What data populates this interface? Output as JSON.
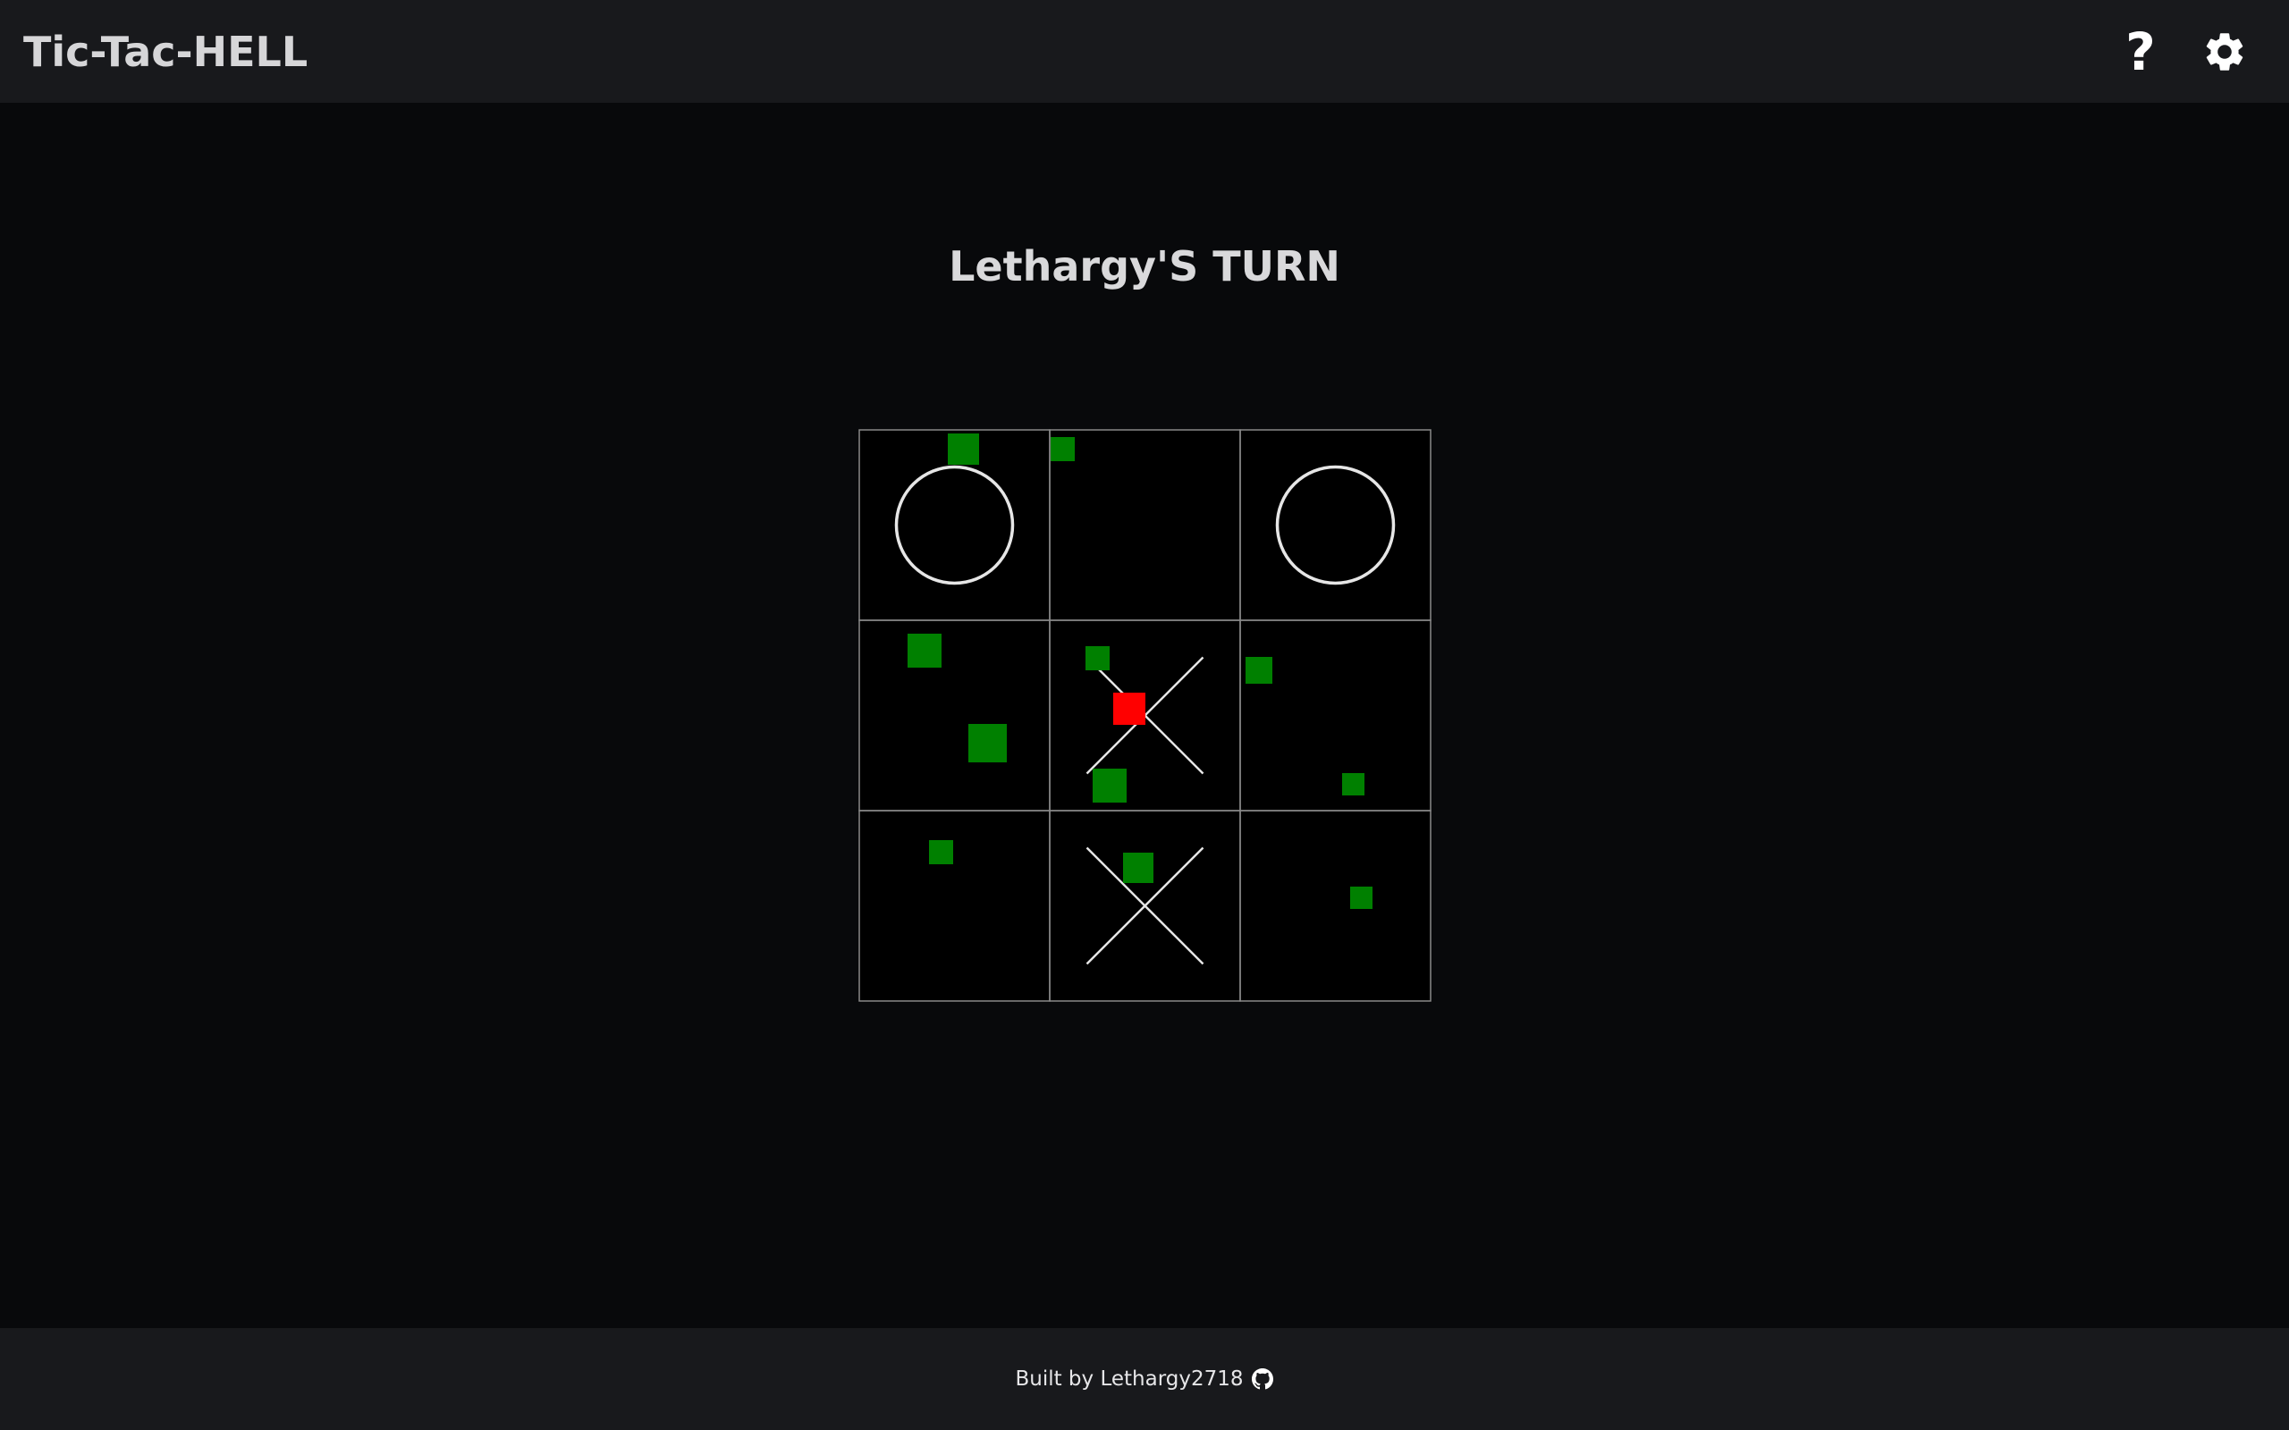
{
  "header": {
    "title": "Tic-Tac-HELL",
    "help_icon": "question-mark-icon",
    "settings_icon": "gear-icon",
    "help_glyph": "?"
  },
  "game": {
    "turn_text": "Lethargy'S TURN",
    "board": [
      [
        "O",
        "",
        "O"
      ],
      [
        "",
        "X",
        ""
      ],
      [
        "",
        "X",
        ""
      ]
    ],
    "colors": {
      "background": "#000000",
      "grid": "#8a8a8a",
      "mark": "#e6e6e6",
      "green_block": "#008000",
      "red_block": "#ff0000"
    }
  },
  "footer": {
    "text": "Built by Lethargy2718",
    "github_icon": "github-icon"
  }
}
